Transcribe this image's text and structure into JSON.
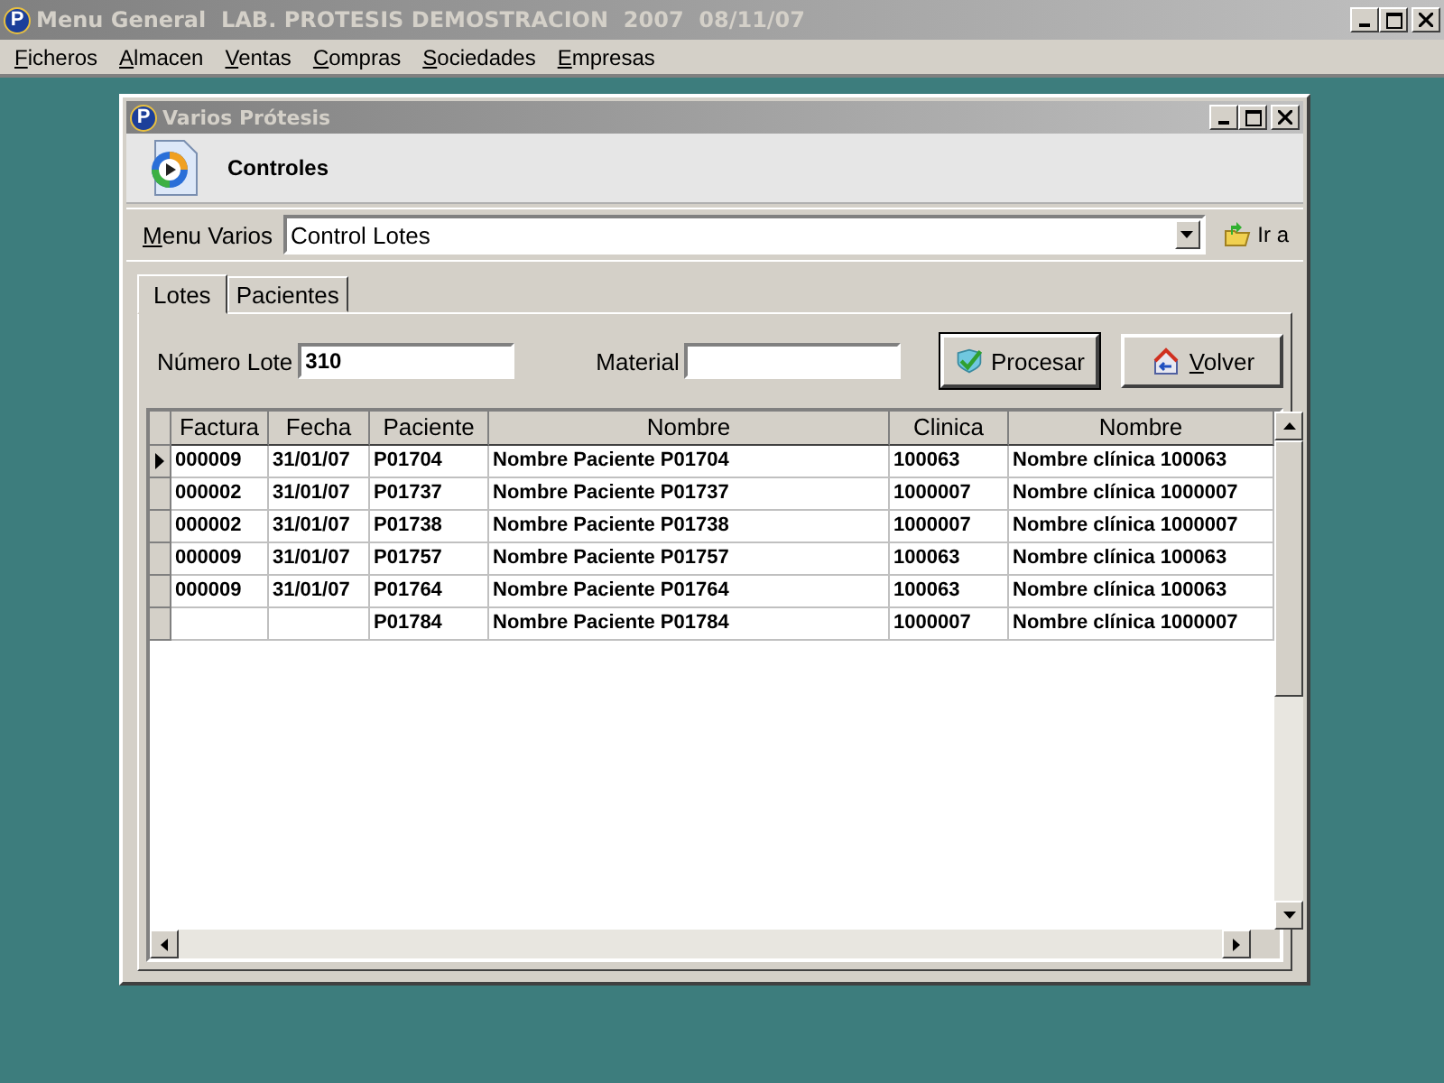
{
  "window": {
    "logo": "P",
    "title": "Menu General  LAB. PROTESIS DEMOSTRACION  2007  08/11/07"
  },
  "menu": [
    "Ficheros",
    "Almacen",
    "Ventas",
    "Compras",
    "Sociedades",
    "Empresas"
  ],
  "child_window": {
    "logo": "P",
    "title": "Varios Prótesis",
    "header": "Controles",
    "menu_varios": {
      "label": "Menu Varios",
      "value": "Control Lotes",
      "go_button": "Ir a"
    },
    "tabs": [
      {
        "label": "Lotes",
        "selected": true
      },
      {
        "label": "Pacientes",
        "selected": false
      }
    ],
    "fields": [
      {
        "label": "Número Lote",
        "value": "310"
      },
      {
        "label": "Material"
      }
    ],
    "buttons": [
      {
        "label": "Procesar",
        "kind": "process"
      },
      {
        "label": "Volver",
        "kind": "back"
      }
    ],
    "table": {
      "columns": [
        "Factura",
        "Fecha",
        "Paciente",
        "Nombre",
        "Clinica",
        "Nombre"
      ],
      "rows": [
        {
          "current": true,
          "cells": [
            "000009",
            "31/01/07",
            "P01704",
            "Nombre Paciente P01704",
            "100063",
            "Nombre clínica 100063"
          ]
        },
        {
          "current": false,
          "cells": [
            "000002",
            "31/01/07",
            "P01737",
            "Nombre Paciente P01737",
            "1000007",
            "Nombre clínica 1000007"
          ]
        },
        {
          "current": false,
          "cells": [
            "000002",
            "31/01/07",
            "P01738",
            "Nombre Paciente P01738",
            "1000007",
            "Nombre clínica 1000007"
          ]
        },
        {
          "current": false,
          "cells": [
            "000009",
            "31/01/07",
            "P01757",
            "Nombre Paciente P01757",
            "100063",
            "Nombre clínica 100063"
          ]
        },
        {
          "current": false,
          "cells": [
            "000009",
            "31/01/07",
            "P01764",
            "Nombre Paciente P01764",
            "100063",
            "Nombre clínica 100063"
          ]
        },
        {
          "current": false,
          "cells": [
            null,
            null,
            "P01784",
            "Nombre Paciente P01784",
            "1000007",
            "Nombre clínica 1000007"
          ]
        }
      ]
    }
  }
}
